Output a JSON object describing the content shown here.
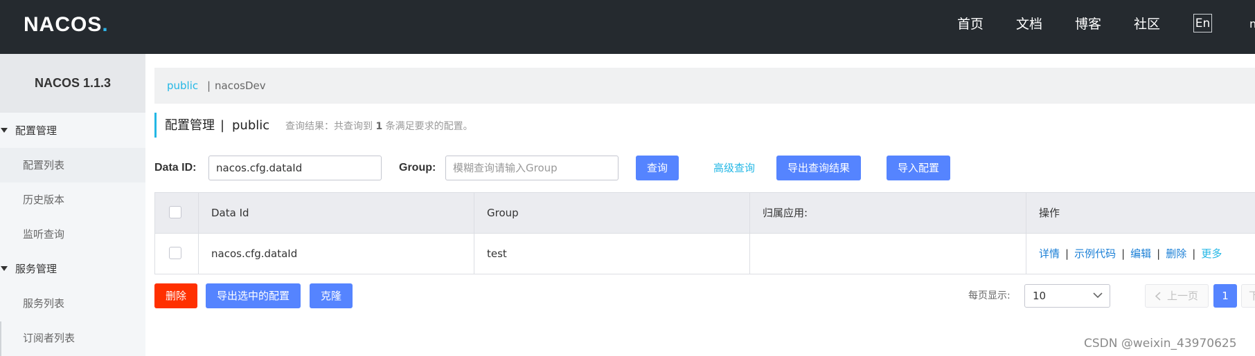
{
  "header": {
    "logo_text": "NACOS",
    "logo_dot": ".",
    "nav": [
      "首页",
      "文档",
      "博客",
      "社区"
    ],
    "lang_button": "En",
    "nav_overflow": "n"
  },
  "sidebar": {
    "version": "NACOS 1.1.3",
    "groups": [
      {
        "label": "配置管理",
        "items": [
          "配置列表",
          "历史版本",
          "监听查询"
        ]
      },
      {
        "label": "服务管理",
        "items": [
          "服务列表",
          "订阅者列表"
        ]
      }
    ],
    "active_item": "配置列表"
  },
  "namespace_bar": {
    "active": "public",
    "separator": "|",
    "other": "nacosDev"
  },
  "title": {
    "main": "配置管理",
    "separator": "|",
    "namespace": "public",
    "query_prefix": "查询结果：共查询到",
    "query_count": "1",
    "query_suffix": "条满足要求的配置。"
  },
  "search": {
    "data_id_label": "Data ID:",
    "data_id_value": "nacos.cfg.dataId",
    "group_label": "Group:",
    "group_placeholder": "模糊查询请输入Group",
    "query_button": "查询",
    "advanced_link": "高级查询",
    "export_button": "导出查询结果",
    "import_button": "导入配置"
  },
  "table": {
    "columns": [
      "Data Id",
      "Group",
      "归属应用:",
      "操作"
    ],
    "rows": [
      {
        "data_id": "nacos.cfg.dataId",
        "group": "test",
        "app": ""
      }
    ],
    "operations": [
      "详情",
      "示例代码",
      "编辑",
      "删除",
      "更多"
    ]
  },
  "footer": {
    "delete_button": "删除",
    "export_selected_button": "导出选中的配置",
    "clone_button": "克隆",
    "page_size_label": "每页显示:",
    "page_size": "10",
    "prev_label": "上一页",
    "current_page": "1",
    "next_label": "下"
  },
  "watermark": "CSDN @weixin_43970625",
  "colors": {
    "topbar": "#252a2f",
    "accent": "#23b7e5",
    "primary": "#5584ff",
    "danger": "#ff3000",
    "link": "#1a7fd6"
  }
}
